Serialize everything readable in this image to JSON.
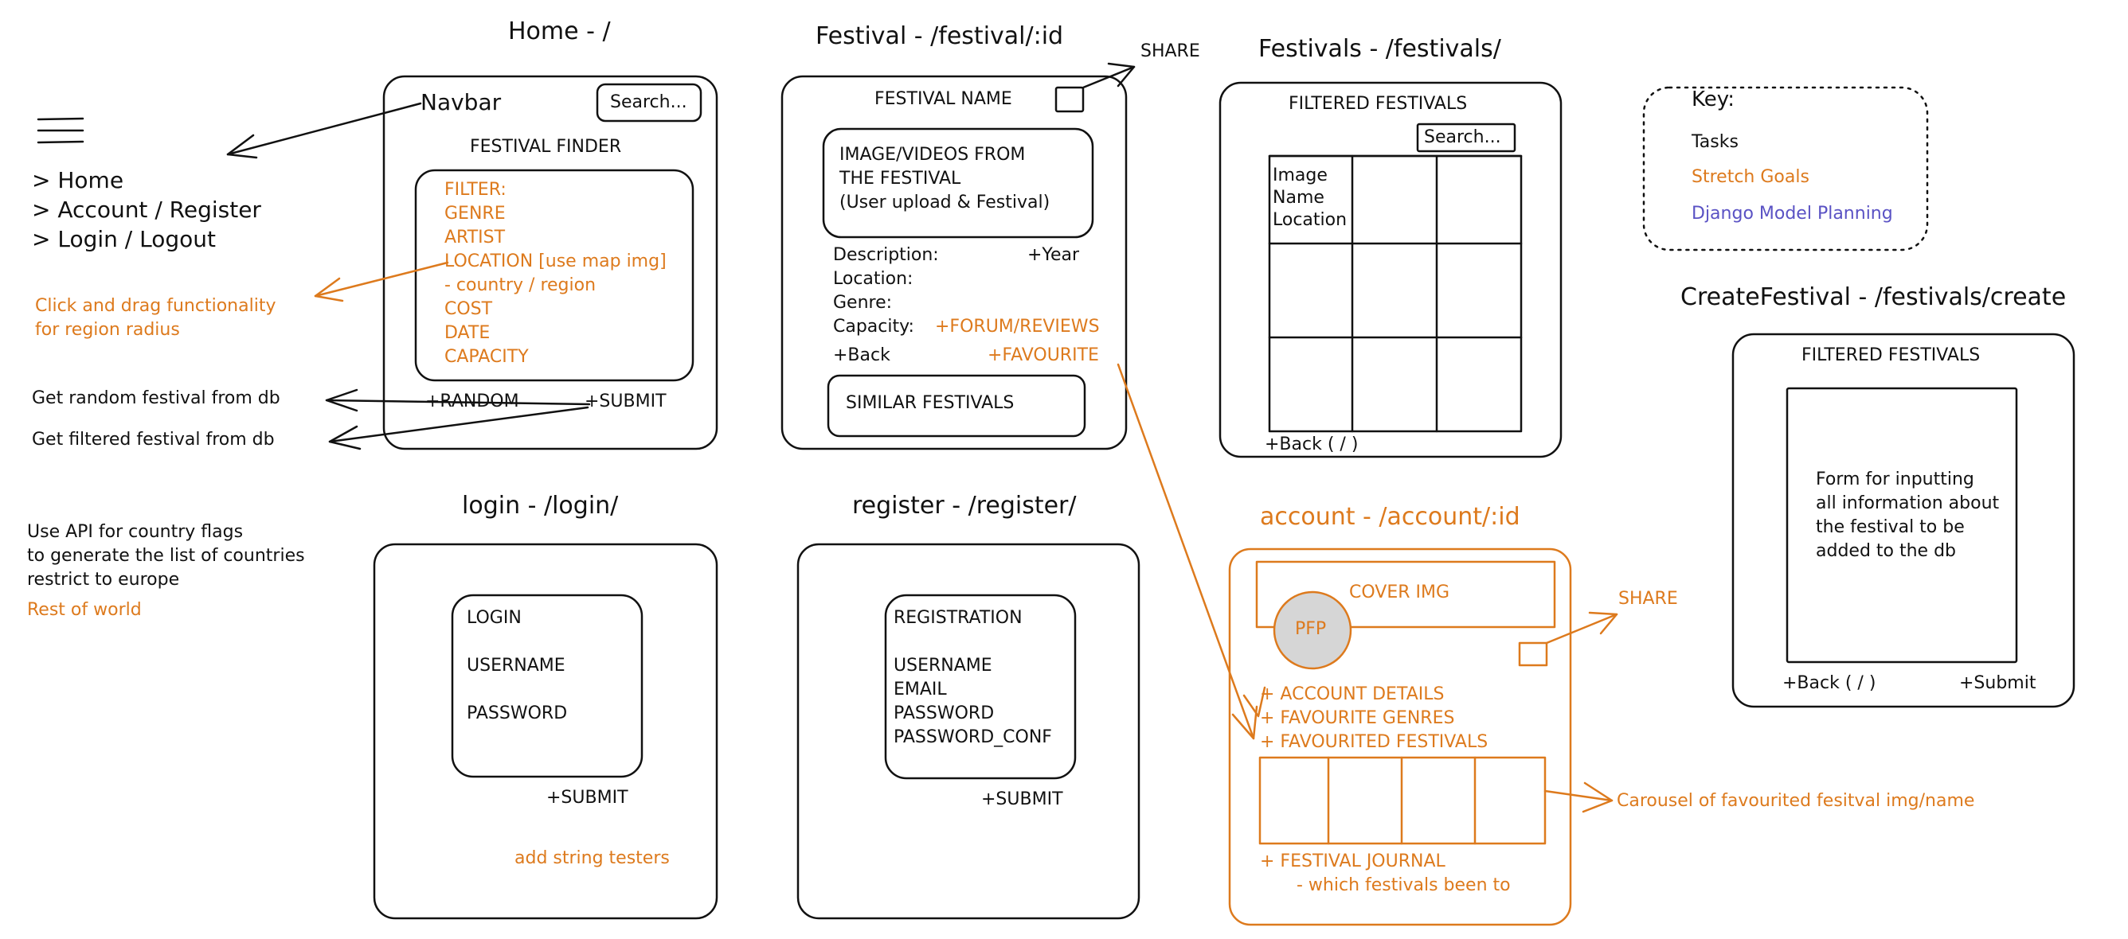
{
  "key": {
    "title": "Key:",
    "tasks": "Tasks",
    "stretch": "Stretch Goals",
    "django": "Django Model Planning"
  },
  "colors": {
    "stroke": "#111111",
    "stretch": "#dd7a1d",
    "django": "#5a52c4",
    "pfp_fill": "#d6d6d6"
  },
  "home": {
    "title": "Home - /",
    "navbar": "Navbar",
    "search": "Search...",
    "finder": "FESTIVAL FINDER",
    "filters": [
      "FILTER:",
      "GENRE",
      "ARTIST",
      "LOCATION [use map img]",
      "- country / region",
      "COST",
      "DATE",
      "CAPACITY"
    ],
    "random": "+RANDOM",
    "submit": "+SUBMIT"
  },
  "menu": {
    "items": [
      "> Home",
      "> Account / Register",
      "> Login / Logout"
    ]
  },
  "notes": {
    "click_drag_1": "Click and drag functionality",
    "click_drag_2": "for region radius",
    "random_note": "Get random festival from db",
    "filtered_note": "Get filtered festival from db",
    "api_1": "Use API for country flags",
    "api_2": "to generate the list of countries",
    "api_3": "restrict to europe",
    "rest": "Rest of world",
    "carousel": "Carousel of favourited fesitval img/name"
  },
  "festival": {
    "title": "Festival - /festival/:id",
    "name": "FESTIVAL NAME",
    "share": "SHARE",
    "image_1": "IMAGE/VIDEOS FROM",
    "image_2": "THE FESTIVAL",
    "image_3": "(User upload & Festival)",
    "description": "Description:",
    "year": "+Year",
    "location": "Location:",
    "genre": "Genre:",
    "capacity": "Capacity:",
    "forum": "+FORUM/REVIEWS",
    "back": "+Back",
    "favourite": "+FAVOURITE",
    "similar": "SIMILAR FESTIVALS"
  },
  "festivals": {
    "title": "Festivals - /festivals/",
    "filtered": "FILTERED FESTIVALS",
    "search": "Search...",
    "cell_1": "Image",
    "cell_2": "Name",
    "cell_3": "Location",
    "back": "+Back ( / )"
  },
  "create": {
    "title": "CreateFestival - /festivals/create",
    "filtered": "FILTERED FESTIVALS",
    "form_1": "Form for inputting",
    "form_2": "all information about",
    "form_3": "the festival to be",
    "form_4": "added to the db",
    "back": "+Back ( / )",
    "submit": "+Submit"
  },
  "login": {
    "title": "login - /login/",
    "heading": "LOGIN",
    "username": "USERNAME",
    "password": "PASSWORD",
    "submit": "+SUBMIT",
    "testers": "add string testers"
  },
  "register": {
    "title": "register - /register/",
    "heading": "REGISTRATION",
    "username": "USERNAME",
    "email": "EMAIL",
    "password": "PASSWORD",
    "password_conf": "PASSWORD_CONF",
    "submit": "+SUBMIT"
  },
  "account": {
    "title": "account - /account/:id",
    "cover": "COVER IMG",
    "pfp": "PFP",
    "share": "SHARE",
    "details": "+ ACCOUNT DETAILS",
    "genres": "+ FAVOURITE GENRES",
    "festivals": "+ FAVOURITED FESTIVALS",
    "journal": "+ FESTIVAL JOURNAL",
    "journal_sub": "- which festivals been to"
  }
}
